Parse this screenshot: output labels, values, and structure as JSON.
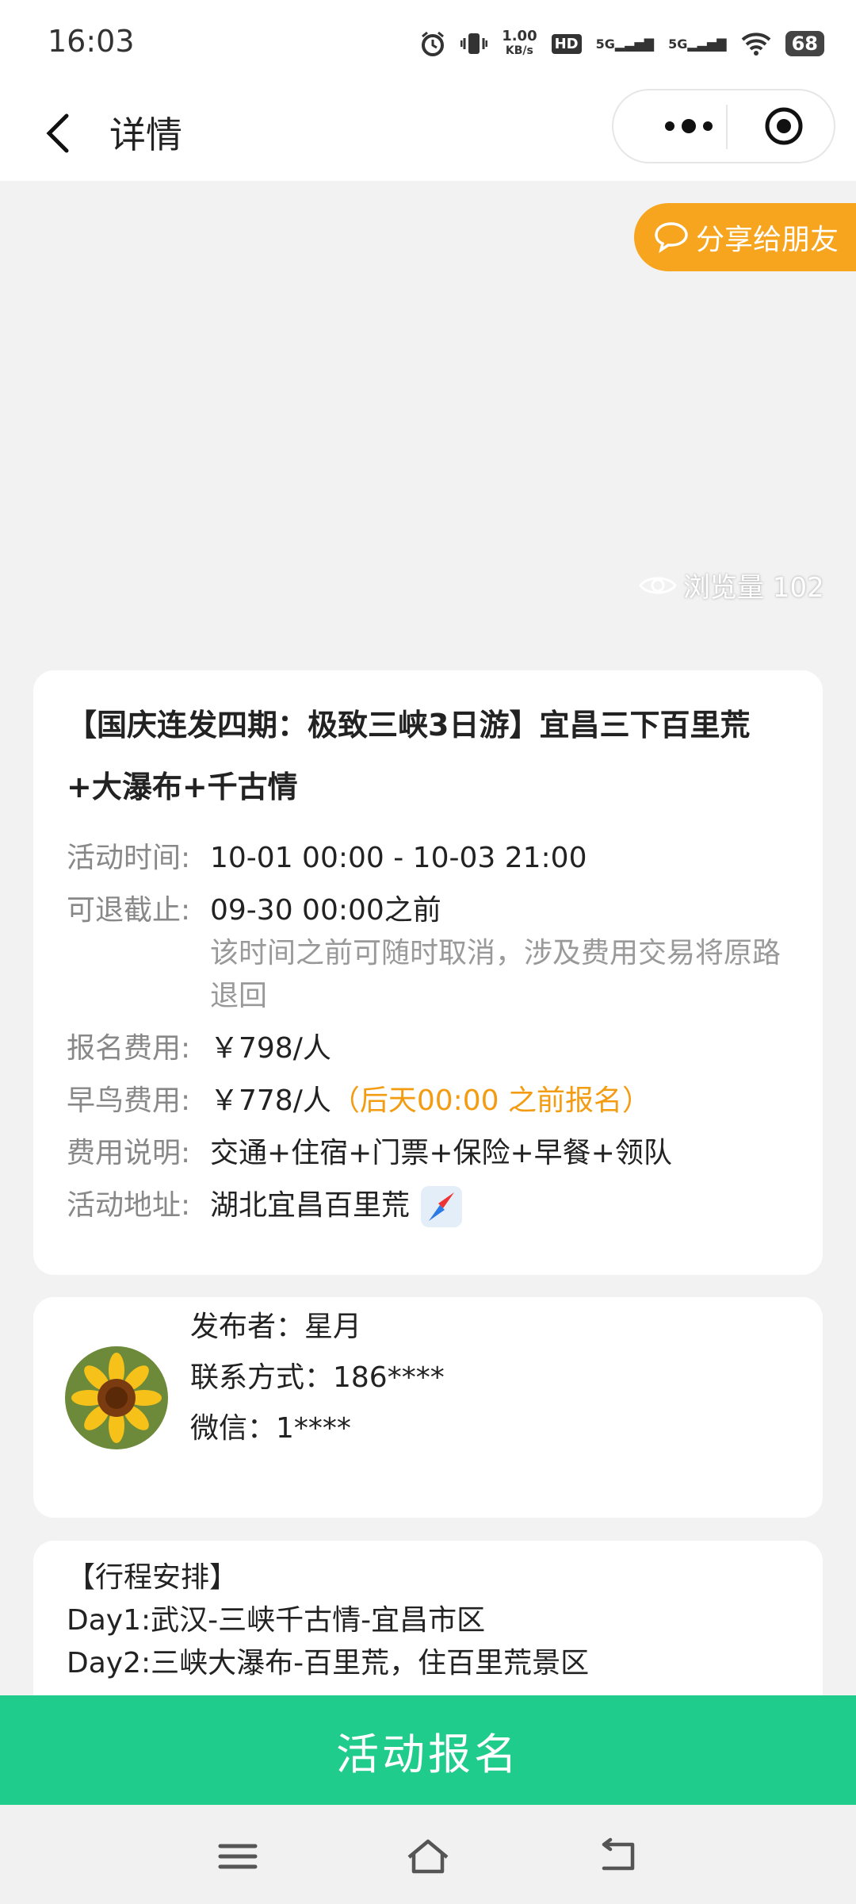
{
  "status": {
    "time": "16:03",
    "speed_value": "1.00",
    "speed_unit": "KB/s",
    "hd_label": "HD",
    "sim1": "5G",
    "sim2": "5G",
    "battery": "68"
  },
  "nav": {
    "title": "详情",
    "back_icon": "chevron-left-icon",
    "more_icon": "more-dots-icon",
    "close_icon": "target-icon"
  },
  "share": {
    "label": "分享给朋友"
  },
  "views": {
    "label": "浏览量 102"
  },
  "event": {
    "title": "【国庆连发四期：极致三峡3日游】宜昌三下百里荒+大瀑布+千古情",
    "rows": [
      {
        "label": "活动时间:",
        "value": "10-01 00:00 - 10-03 21:00"
      },
      {
        "label": "可退截止:",
        "value": "09-30 00:00之前",
        "note": "该时间之前可随时取消，涉及费用交易将原路退回"
      },
      {
        "label": "报名费用:",
        "value": "￥798/人"
      },
      {
        "label": "早鸟费用:",
        "value": "￥778/人",
        "highlight": "（后天00:00 之前报名）"
      },
      {
        "label": "费用说明:",
        "value": "交通+住宿+门票+保险+早餐+领队"
      },
      {
        "label": "活动地址:",
        "value": "湖北宜昌百里荒"
      }
    ],
    "highlight_color": "#f39c12"
  },
  "publisher": {
    "name_line": "发布者：星月",
    "contact_line": "联系方式：186****",
    "wechat_line": "微信：1****"
  },
  "itinerary": {
    "heading": "【行程安排】",
    "day1": "Day1:武汉-三峡千古情-宜昌市区",
    "day2": "Day2:三峡大瀑布-百里荒，住百里荒景区"
  },
  "signup": {
    "label": "活动报名",
    "color": "#1fcc8c"
  },
  "colors": {
    "accent_orange": "#f7a51e",
    "green": "#1fcc8c"
  }
}
